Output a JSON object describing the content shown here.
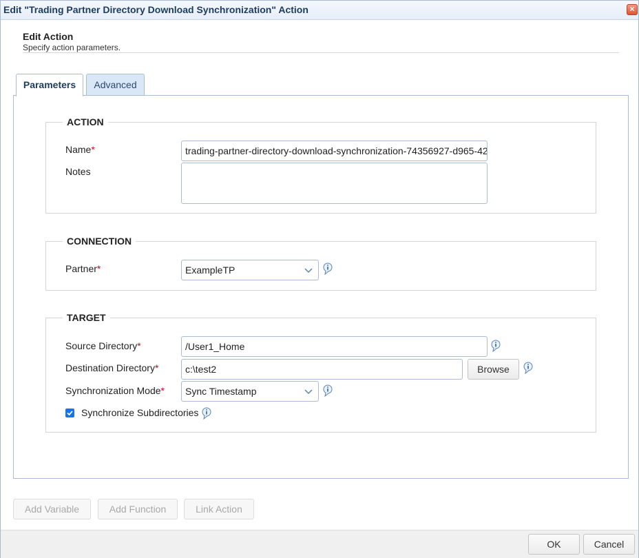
{
  "window": {
    "title": "Edit \"Trading Partner Directory Download Synchronization\" Action"
  },
  "header": {
    "title": "Edit Action",
    "subtitle": "Specify action parameters."
  },
  "tabs": [
    {
      "label": "Parameters",
      "active": true
    },
    {
      "label": "Advanced",
      "active": false
    }
  ],
  "action": {
    "legend": "ACTION",
    "name_label": "Name",
    "name_value": "trading-partner-directory-download-synchronization-74356927-d965-42",
    "notes_label": "Notes",
    "notes_value": ""
  },
  "connection": {
    "legend": "CONNECTION",
    "partner_label": "Partner",
    "partner_value": "ExampleTP"
  },
  "target": {
    "legend": "TARGET",
    "source_label": "Source Directory",
    "source_value": "/User1_Home",
    "dest_label": "Destination Directory",
    "dest_value": "c:\\test2",
    "browse_label": "Browse",
    "mode_label": "Synchronization Mode",
    "mode_value": "Sync Timestamp",
    "subdirs_label": "Synchronize Subdirectories",
    "subdirs_checked": true
  },
  "required_marker": "*",
  "toolbar": {
    "add_variable": "Add Variable",
    "add_function": "Add Function",
    "link_action": "Link Action"
  },
  "footer": {
    "ok": "OK",
    "cancel": "Cancel"
  },
  "icons": {
    "close": "close-icon",
    "info": "info-icon",
    "dropdown": "chevron-down-icon",
    "check": "check-icon"
  },
  "colors": {
    "accent": "#1a73e8",
    "required": "#d0021b",
    "border": "#a9bcd4",
    "tab_inactive": "#d9e7f7",
    "title_text": "#1d3a5f"
  }
}
